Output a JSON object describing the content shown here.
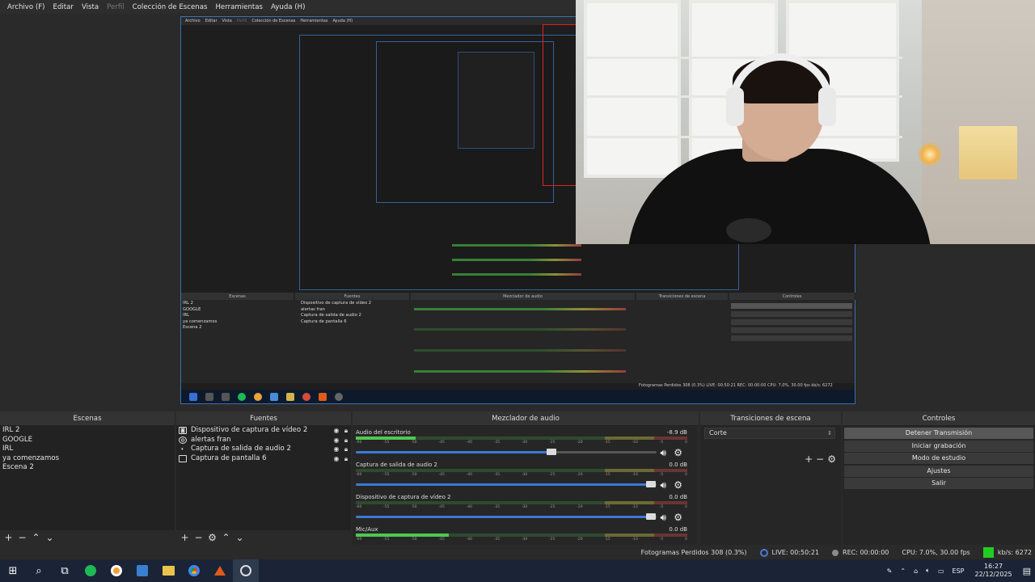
{
  "menu": {
    "items": [
      "Archivo (F)",
      "Editar",
      "Vista",
      "Perfil",
      "Colección de Escenas",
      "Herramientas",
      "Ayuda (H)"
    ],
    "disabled_index": 3
  },
  "nested": {
    "menu": [
      "Archivo",
      "Editar",
      "Vista",
      "Perfil",
      "Colección de Escenas",
      "Herramientas",
      "Ayuda (H)"
    ],
    "headers": {
      "scenes": "Escenas",
      "sources": "Fuentes",
      "mixer": "Mezclador de audio",
      "transitions": "Transiciones de escena",
      "controls": "Controles"
    },
    "scenes": [
      "IRL 2",
      "GOOGLE",
      "IRL",
      "ya comenzamos",
      "Escena 2"
    ],
    "sources": [
      "Dispositivo de captura de vídeo 2",
      "alertas fran",
      "Captura de salida de audio 2",
      "Captura de pantalla 6"
    ],
    "status": "Fotogramas Perdidos 308 (0.3%)   LIVE: 00:50:21   REC: 00:00:00   CPU: 7.0%, 30.00 fps   kb/s: 6272"
  },
  "headers": {
    "scenes": "Escenas",
    "sources": "Fuentes",
    "mixer": "Mezclador de audio",
    "transitions": "Transiciones de escena",
    "controls": "Controles"
  },
  "scenes": [
    "IRL 2",
    "GOOGLE",
    "IRL",
    "ya comenzamos",
    "Escena 2"
  ],
  "sources": [
    {
      "label": "Dispositivo de captura de vídeo 2",
      "icon": "camera-icon"
    },
    {
      "label": "alertas fran",
      "icon": "globe-icon"
    },
    {
      "label": "Captura de salida de audio 2",
      "icon": "speaker-icon"
    },
    {
      "label": "Captura de pantalla 6",
      "icon": "monitor-icon"
    }
  ],
  "mixer": {
    "ticks": [
      "-60",
      "-55",
      "-50",
      "-45",
      "-40",
      "-35",
      "-30",
      "-25",
      "-20",
      "-15",
      "-10",
      "-5",
      "0"
    ],
    "channels": [
      {
        "name": "Audio del escritorio",
        "db": "-8.9 dB",
        "level": 0.18,
        "volume": 0.65
      },
      {
        "name": "Captura de salida de audio 2",
        "db": "0.0 dB",
        "level": 0.0,
        "volume": 0.98
      },
      {
        "name": "Dispositivo de captura de vídeo 2",
        "db": "0.0 dB",
        "level": 0.0,
        "volume": 0.98
      },
      {
        "name": "Mic/Aux",
        "db": "0.0 dB",
        "level": 0.28,
        "volume": null
      }
    ]
  },
  "transitions": {
    "selected": "Corte"
  },
  "controls": [
    "Detener Transmisión",
    "Iniciar grabación",
    "Modo de estudio",
    "Ajustes",
    "Salir"
  ],
  "status": {
    "dropped": "Fotogramas Perdidos 308 (0.3%)",
    "live": "LIVE: 00:50:21",
    "rec": "REC: 00:00:00",
    "cpu": "CPU: 7.0%, 30.00 fps",
    "kbs": "kb/s: 6272"
  },
  "taskbar": {
    "lang": "ESP",
    "time": "16:27",
    "date": "22/12/2025"
  },
  "colors": {
    "accent": "#3b79d6",
    "live_green": "#22cc22",
    "red_box": "#dd2222"
  }
}
